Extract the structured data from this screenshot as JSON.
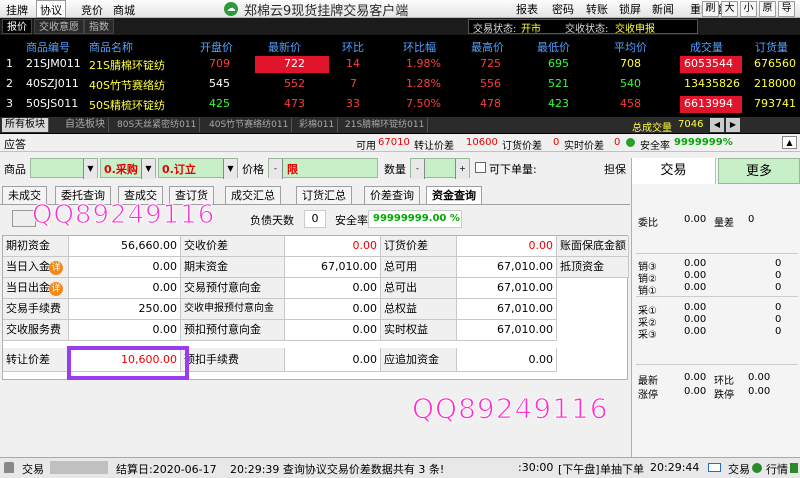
{
  "menu": [
    "挂牌",
    "协议",
    "竞价",
    "商城"
  ],
  "app_title": "郑棉云9现货挂牌交易客户端",
  "right_menu": [
    "报表",
    "密码",
    "转账",
    "锁屏",
    "新闻",
    "重新登录"
  ],
  "icon_buttons": [
    "刷",
    "大",
    "小",
    "原",
    "导"
  ],
  "quote_tabs": [
    "报价",
    "交收意愿",
    "指数"
  ],
  "status": {
    "trade_label": "交易状态:",
    "trade_value": "开市",
    "delivery_label": "交收状态:",
    "delivery_value": "交收申报"
  },
  "quote_headers": [
    "商品编号",
    "商品名称",
    "开盘价",
    "最新价",
    "环比",
    "环比幅",
    "最高价",
    "最低价",
    "平均价",
    "成交量",
    "订货量"
  ],
  "quote_rows": [
    {
      "idx": "1",
      "code": "21SJM011",
      "name": "21S腈棉环锭纺",
      "open": "709",
      "last": "722",
      "chg": "14",
      "pct": "1.98%",
      "high": "725",
      "low": "695",
      "avg": "708",
      "vol": "6053544",
      "oi": "676560"
    },
    {
      "idx": "2",
      "code": "40SZJ011",
      "name": "40S竹节赛络纺",
      "open": "545",
      "last": "552",
      "chg": "7",
      "pct": "1.28%",
      "high": "556",
      "low": "521",
      "avg": "540",
      "vol": "13435826",
      "oi": "218000"
    },
    {
      "idx": "3",
      "code": "50SJS011",
      "name": "50S精梳环锭纺",
      "open": "425",
      "last": "473",
      "chg": "33",
      "pct": "7.50%",
      "high": "478",
      "low": "423",
      "avg": "458",
      "vol": "6613994",
      "oi": "793741"
    }
  ],
  "board_tabs": [
    "所有板块",
    "自选板块",
    "80S天丝紧密纺011",
    "40S竹节赛络纺011",
    "彩棉011",
    "21S腈棉环锭纺011"
  ],
  "total_volume": {
    "label": "总成交量",
    "value": "7046"
  },
  "bar2": {
    "left": "应答",
    "avail_label": "可用",
    "avail": "67010",
    "transfer_label": "转让价差",
    "transfer": "10600",
    "order_label": "订货价差",
    "order": "0",
    "realtime_label": "实时价差",
    "realtime": "0",
    "safety_label": "安全率",
    "safety": "9999999%"
  },
  "order_form": {
    "goods_label": "商品",
    "buy": "0.采购",
    "open": "0.订立",
    "price_label": "价格",
    "price_value": "限",
    "qty_label": "数量",
    "available_label": "可下单量:",
    "sign_label": "担保"
  },
  "sub_tabs": [
    "未成交",
    "委托查询",
    "查成交",
    "查订货",
    "成交汇总",
    "订货汇总",
    "价差查询",
    "资金查询"
  ],
  "debt_days": {
    "label": "负债天数",
    "value": "0",
    "safety_label": "安全率",
    "safety_value": "99999999.00 %"
  },
  "funds": [
    {
      "l1": "期初资金",
      "v1": "56,660.00",
      "l2": "交收价差",
      "v2": "0.00",
      "l3": "订货价差",
      "v3": "0.00",
      "l4": "账面保底金额"
    },
    {
      "l1": "当日入金",
      "v1": "0.00",
      "l2": "期末资金",
      "v2": "67,010.00",
      "l3": "总可用",
      "v3": "67,010.00",
      "l4": "抵顶资金"
    },
    {
      "l1": "当日出金",
      "v1": "0.00",
      "l2": "交易预付意向金",
      "v2": "0.00",
      "l3": "总可出",
      "v3": "67,010.00",
      "l4": ""
    },
    {
      "l1": "交易手续费",
      "v1": "250.00",
      "l2": "交收申报预付意向金",
      "v2": "0.00",
      "l3": "总权益",
      "v3": "67,010.00",
      "l4": ""
    },
    {
      "l1": "交收服务费",
      "v1": "0.00",
      "l2": "预扣预付意向金",
      "v2": "0.00",
      "l3": "实时权益",
      "v3": "67,010.00",
      "l4": ""
    },
    {
      "l1": "转让价差",
      "v1": "10,600.00",
      "l2": "预扣手续费",
      "v2": "0.00",
      "l3": "应追加资金",
      "v3": "0.00",
      "l4": ""
    }
  ],
  "detail_badge": "详",
  "right_panel": {
    "tab1": "交易",
    "tab2": "更多",
    "weibi_label": "委比",
    "weibi": "0.00",
    "liangcha_label": "量差",
    "liangcha": "0",
    "sell": [
      {
        "label": "销③",
        "price": "0.00",
        "qty": "0"
      },
      {
        "label": "销②",
        "price": "0.00",
        "qty": "0"
      },
      {
        "label": "销①",
        "price": "0.00",
        "qty": "0"
      }
    ],
    "buy": [
      {
        "label": "采①",
        "price": "0.00",
        "qty": "0"
      },
      {
        "label": "采②",
        "price": "0.00",
        "qty": "0"
      },
      {
        "label": "采③",
        "price": "0.00",
        "qty": "0"
      }
    ],
    "latest_label": "最新",
    "latest": "0.00",
    "huanbi_label": "环比",
    "huanbi": "0.00",
    "zhangting_label": "涨停",
    "zhangting": "0.00",
    "dieting_label": "跌停",
    "dieting": "0.00"
  },
  "watermark": "QQ89249116",
  "status_bar": {
    "trade": "交易",
    "settle": "结算日:2020-06-17",
    "msg": "20:29:39  查询协议交易价差数据共有 3 条!",
    "time1": ":30:00",
    "session": "[下午盘]",
    "single": "单抽下单",
    "time2": "20:29:44",
    "trade2": "交易",
    "quote": "行情"
  },
  "colors": {
    "red": "#e0142a",
    "green": "#2fff2f",
    "yellow": "#ffff3c",
    "blue": "#55a0ff"
  }
}
